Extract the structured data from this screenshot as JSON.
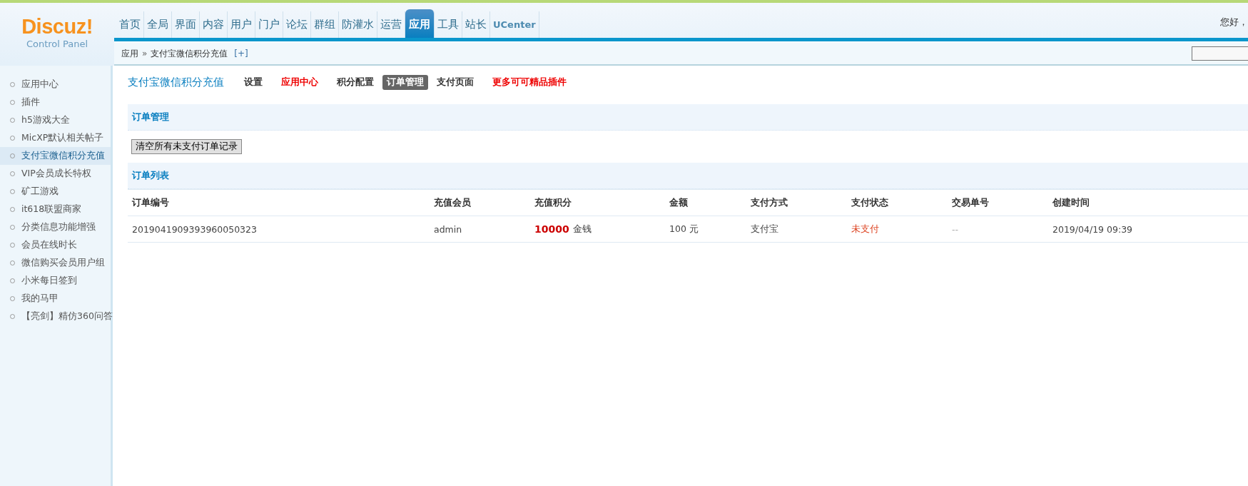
{
  "logo": {
    "name": "Discuz!",
    "subtitle": "Control Panel"
  },
  "nav": [
    {
      "label": "首页",
      "selected": false
    },
    {
      "label": "全局",
      "selected": false
    },
    {
      "label": "界面",
      "selected": false
    },
    {
      "label": "内容",
      "selected": false
    },
    {
      "label": "用户",
      "selected": false
    },
    {
      "label": "门户",
      "selected": false
    },
    {
      "label": "论坛",
      "selected": false
    },
    {
      "label": "群组",
      "selected": false
    },
    {
      "label": "防灌水",
      "selected": false
    },
    {
      "label": "运营",
      "selected": false
    },
    {
      "label": "应用",
      "selected": true
    },
    {
      "label": "工具",
      "selected": false
    },
    {
      "label": "站长",
      "selected": false
    },
    {
      "label": "UCenter",
      "selected": false
    }
  ],
  "greeting": "您好，",
  "breadcrumb": {
    "parent": "应用",
    "separator": "»",
    "current": "支付宝微信积分充值",
    "add": "[+]"
  },
  "sidebar": {
    "items": [
      {
        "label": "应用中心",
        "selected": false
      },
      {
        "label": "插件",
        "selected": false
      },
      {
        "label": "h5游戏大全",
        "selected": false
      },
      {
        "label": "MicXP默认相关帖子",
        "selected": false
      },
      {
        "label": "支付宝微信积分充值",
        "selected": true
      },
      {
        "label": "VIP会员成长特权",
        "selected": false
      },
      {
        "label": "矿工游戏",
        "selected": false
      },
      {
        "label": "it618联盟商家",
        "selected": false
      },
      {
        "label": "分类信息功能增强",
        "selected": false
      },
      {
        "label": "会员在线时长",
        "selected": false
      },
      {
        "label": "微信购买会员用户组",
        "selected": false
      },
      {
        "label": "小米每日签到",
        "selected": false
      },
      {
        "label": "我的马甲",
        "selected": false
      },
      {
        "label": "【亮剑】精仿360问答",
        "selected": false
      }
    ]
  },
  "plugin": {
    "title": "支付宝微信积分充值",
    "tabs": [
      {
        "label": "设置",
        "kind": "normal",
        "selected": false
      },
      {
        "label": "应用中心",
        "kind": "highlight",
        "selected": false
      },
      {
        "label": "积分配置",
        "kind": "normal",
        "selected": false
      },
      {
        "label": "订单管理",
        "kind": "normal",
        "selected": true
      },
      {
        "label": "支付页面",
        "kind": "normal",
        "selected": false
      },
      {
        "label": "更多可可精品插件",
        "kind": "highlight",
        "selected": false
      }
    ]
  },
  "manage": {
    "title": "订单管理",
    "button": "清空所有未支付订单记录"
  },
  "orders": {
    "title": "订单列表",
    "columns": [
      "订单编号",
      "充值会员",
      "充值积分",
      "金额",
      "支付方式",
      "支付状态",
      "交易单号",
      "创建时间"
    ],
    "rows": [
      [
        {
          "kind": "text",
          "text": "2019041909393960050323"
        },
        {
          "kind": "text",
          "text": "admin"
        },
        {
          "kind": "points",
          "text": "10000",
          "unit": "金钱"
        },
        {
          "kind": "text",
          "text": "100 元"
        },
        {
          "kind": "text",
          "text": "支付宝"
        },
        {
          "kind": "status",
          "text": "未支付"
        },
        {
          "kind": "muted",
          "text": "--"
        },
        {
          "kind": "text",
          "text": "2019/04/19 09:39"
        }
      ]
    ]
  }
}
